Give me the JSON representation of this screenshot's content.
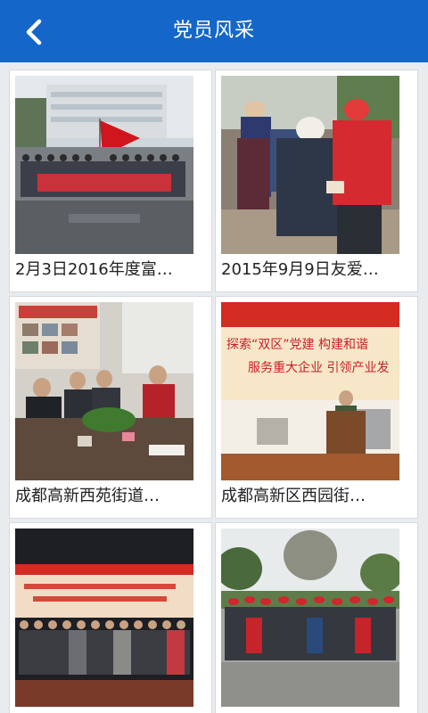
{
  "header": {
    "title": "党员风采",
    "back_icon": "chevron-left-icon"
  },
  "colors": {
    "header_bg": "#1467c8",
    "page_bg": "#e9ecef"
  },
  "items": [
    {
      "caption": "2月3日2016年度富…",
      "image": "group-photo-red-flag"
    },
    {
      "caption": "2015年9月9日友爱…",
      "image": "volunteer-elderly-visit"
    },
    {
      "caption": "成都高新西苑街道…",
      "image": "meeting-table"
    },
    {
      "caption": "成都高新区西园街…",
      "image": "stage-speech-banner"
    },
    {
      "caption": "",
      "image": "hall-group-photo-banner"
    },
    {
      "caption": "",
      "image": "outdoor-group-red-caps"
    }
  ],
  "banner_text": {
    "line1": "探索“双区”党建  构建和谐",
    "line2": "服务重大企业  引领产业发"
  }
}
